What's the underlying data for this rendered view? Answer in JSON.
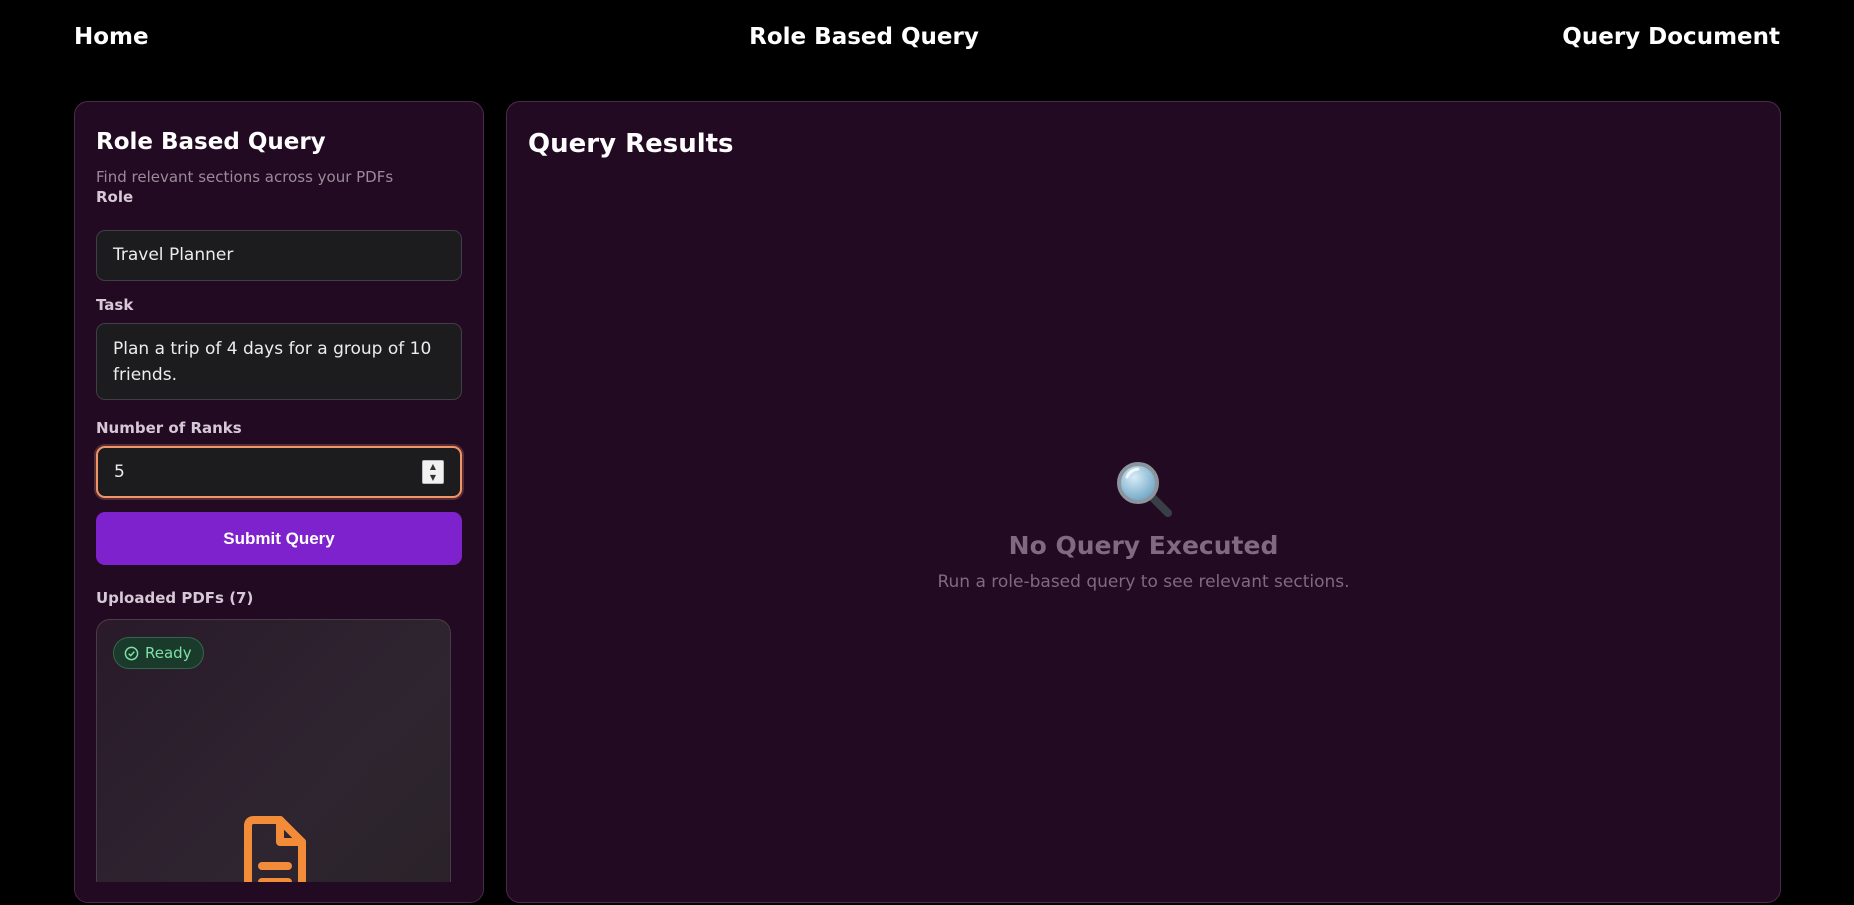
{
  "nav": {
    "home": "Home",
    "center": "Role Based Query",
    "right": "Query Document"
  },
  "sidebar": {
    "title": "Role Based Query",
    "subtitle": "Find relevant sections across your PDFs",
    "role_label": "Role",
    "role_value": "Travel Planner",
    "task_label": "Task",
    "task_value": "Plan a trip of 4 days for a group of 10 friends.",
    "ranks_label": "Number of Ranks",
    "ranks_value": "5",
    "submit_label": "Submit Query",
    "uploaded_label": "Uploaded PDFs (7)",
    "pdf_card": {
      "status": "Ready",
      "status_icon": "check-circle-icon",
      "file_icon": "document-icon"
    }
  },
  "results": {
    "title": "Query Results",
    "empty_icon": "magnifying-glass-icon",
    "empty_title": "No Query Executed",
    "empty_description": "Run a role-based query to see relevant sections."
  },
  "colors": {
    "background": "#000000",
    "panel": "#230a23",
    "accent": "#7e22ce",
    "focus_ring": "#f0946a",
    "ready": "#7ee0a5",
    "doc_icon": "#f28c38"
  }
}
